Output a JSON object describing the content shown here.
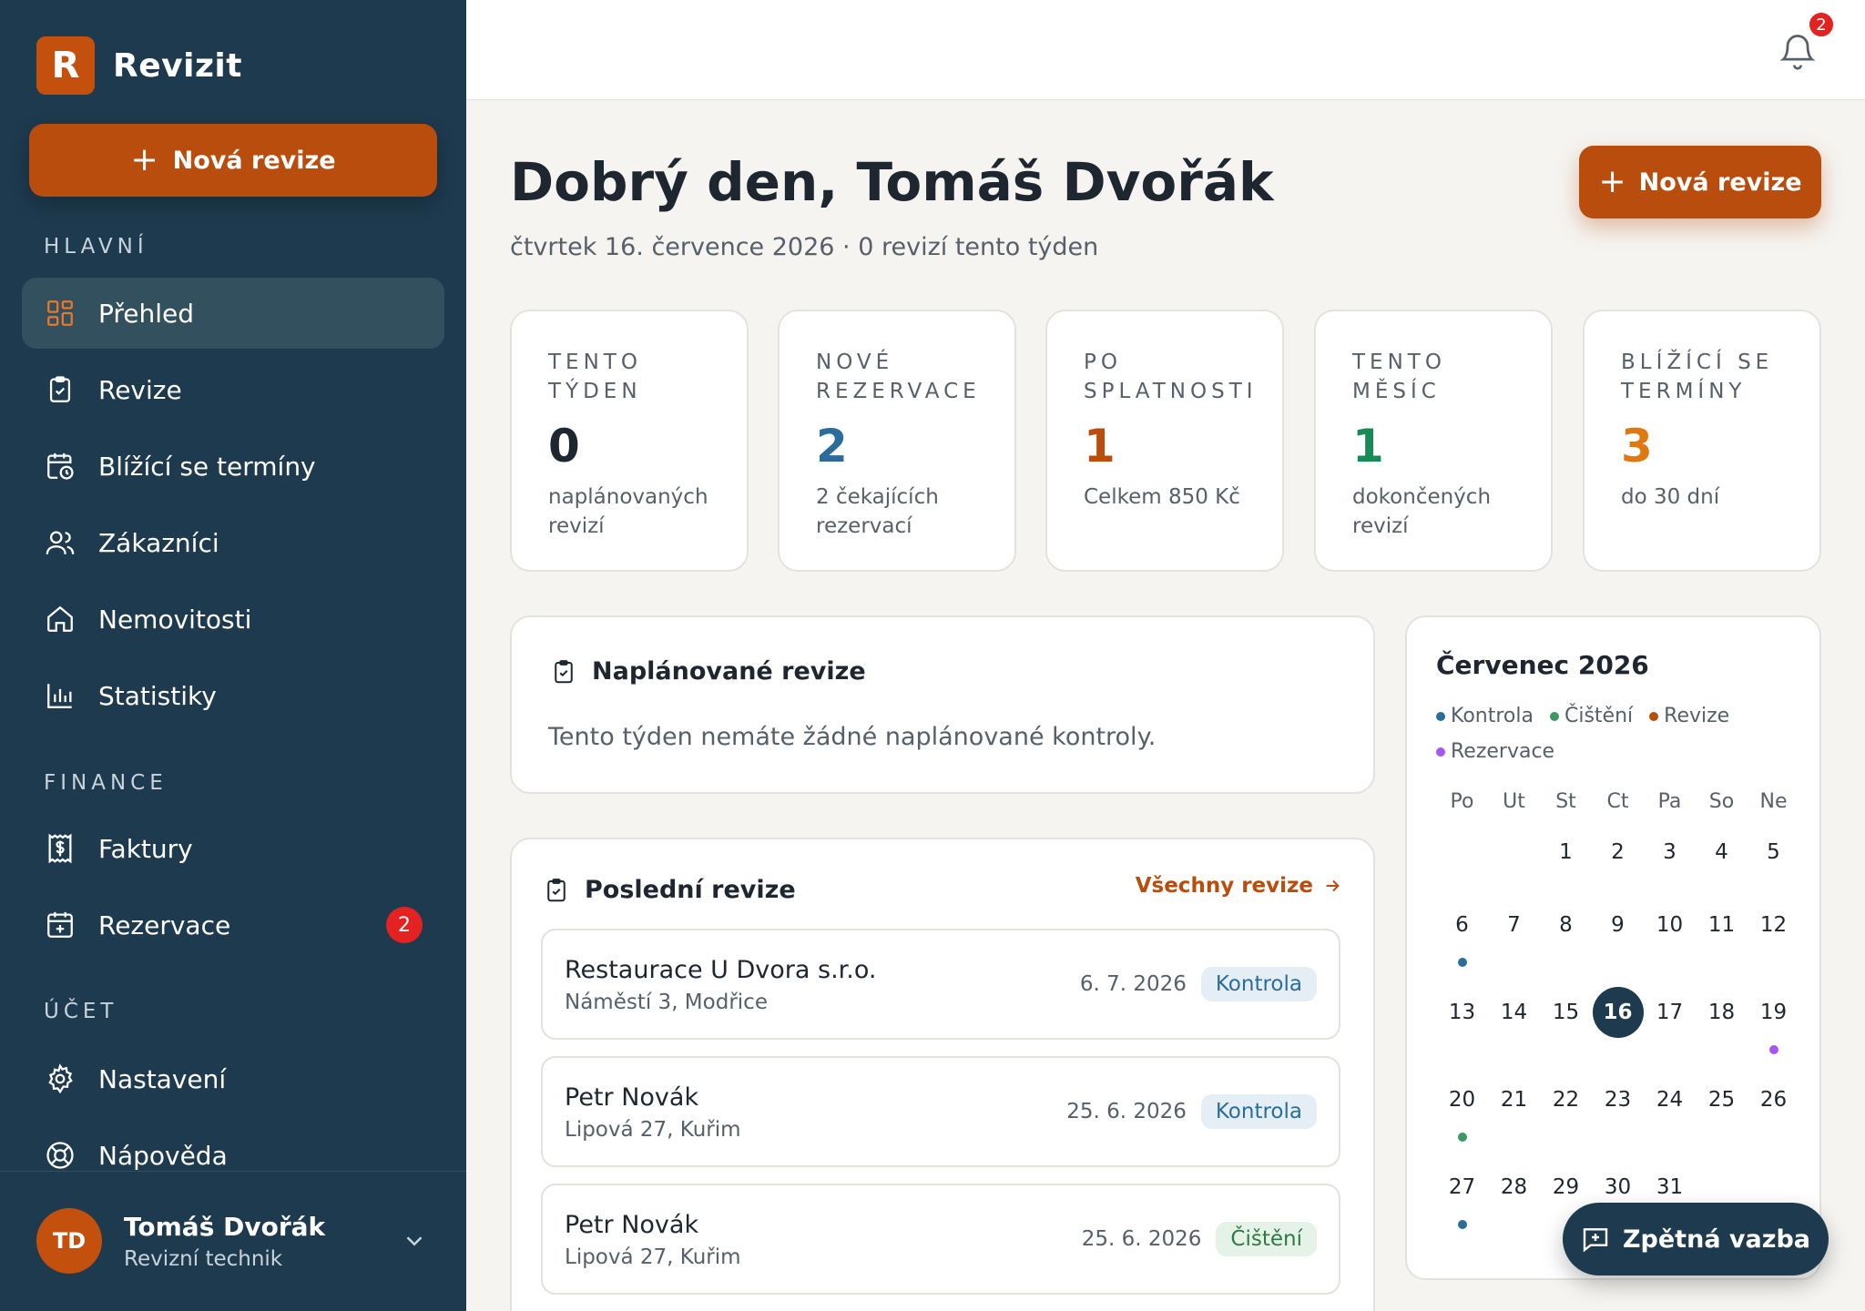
{
  "sidebar": {
    "logo_letter": "R",
    "app_name": "Revizit",
    "new_button": "Nová revize",
    "sections": {
      "main": "HLAVNÍ",
      "finance": "FINANCE",
      "account": "ÚČET"
    },
    "items": {
      "overview": "Přehled",
      "revisions": "Revize",
      "upcoming": "Blížící se termíny",
      "customers": "Zákazníci",
      "properties": "Nemovitosti",
      "statistics": "Statistiky",
      "invoices": "Faktury",
      "reservations": "Rezervace",
      "reservations_badge": "2",
      "settings": "Nastavení",
      "help": "Nápověda"
    },
    "user": {
      "initials": "TD",
      "name": "Tomáš Dvořák",
      "role": "Revizní technik"
    }
  },
  "topbar": {
    "notifications_count": "2"
  },
  "header": {
    "greeting": "Dobrý den, Tomáš Dvořák",
    "subline": "čtvrtek 16. července 2026 · 0 revizí tento týden",
    "new_button": "Nová revize"
  },
  "stats": [
    {
      "label": "TENTO TÝDEN",
      "value": "0",
      "desc": "naplánovaných revizí",
      "color": "#1e2630"
    },
    {
      "label": "NOVÉ REZERVACE",
      "value": "2",
      "desc": "2 čekajících rezervací",
      "color": "#2a6d9c"
    },
    {
      "label": "PO SPLATNOSTI",
      "value": "1",
      "desc": "Celkem 850 Kč",
      "color": "#b94d0d"
    },
    {
      "label": "TENTO MĚSÍC",
      "value": "1",
      "desc": "dokončených revizí",
      "color": "#178a55"
    },
    {
      "label": "BLÍŽÍCÍ SE TERMÍNY",
      "value": "3",
      "desc": "do 30 dní",
      "color": "#e07812"
    }
  ],
  "planned": {
    "title": "Naplánované revize",
    "empty_text": "Tento týden nemáte žádné naplánované kontroly."
  },
  "recent": {
    "title": "Poslední revize",
    "all_link": "Všechny revize",
    "items": [
      {
        "name": "Restaurace U Dvora s.r.o.",
        "address": "Náměstí 3, Modřice",
        "date": "6. 7. 2026",
        "tag": "Kontrola",
        "tag_bg": "#e6eef5",
        "tag_color": "#2a6d9c"
      },
      {
        "name": "Petr Novák",
        "address": "Lipová 27, Kuřim",
        "date": "25. 6. 2026",
        "tag": "Kontrola",
        "tag_bg": "#e6eef5",
        "tag_color": "#2a6d9c"
      },
      {
        "name": "Petr Novák",
        "address": "Lipová 27, Kuřim",
        "date": "25. 6. 2026",
        "tag": "Čištění",
        "tag_bg": "#e4f2e8",
        "tag_color": "#2d7a45"
      }
    ]
  },
  "calendar": {
    "title": "Červenec 2026",
    "legend": [
      {
        "label": "Kontrola",
        "color": "#2a6d9c"
      },
      {
        "label": "Čištění",
        "color": "#3a9a63"
      },
      {
        "label": "Revize",
        "color": "#b94d0d"
      },
      {
        "label": "Rezervace",
        "color": "#a855f7"
      }
    ],
    "weekdays": [
      "Po",
      "Ut",
      "St",
      "Ct",
      "Pa",
      "So",
      "Ne"
    ],
    "weeks": [
      [
        "",
        "",
        "1",
        "2",
        "3",
        "4",
        "5"
      ],
      [
        "6",
        "7",
        "8",
        "9",
        "10",
        "11",
        "12"
      ],
      [
        "13",
        "14",
        "15",
        "16",
        "17",
        "18",
        "19"
      ],
      [
        "20",
        "21",
        "22",
        "23",
        "24",
        "25",
        "26"
      ],
      [
        "27",
        "28",
        "29",
        "30",
        "31",
        "",
        ""
      ]
    ],
    "today": "16",
    "events": {
      "6": "#2a6d9c",
      "19": "#a855f7",
      "20": "#3a9a63",
      "27": "#2a6d9c"
    }
  },
  "feedback_button": "Zpětná vazba"
}
